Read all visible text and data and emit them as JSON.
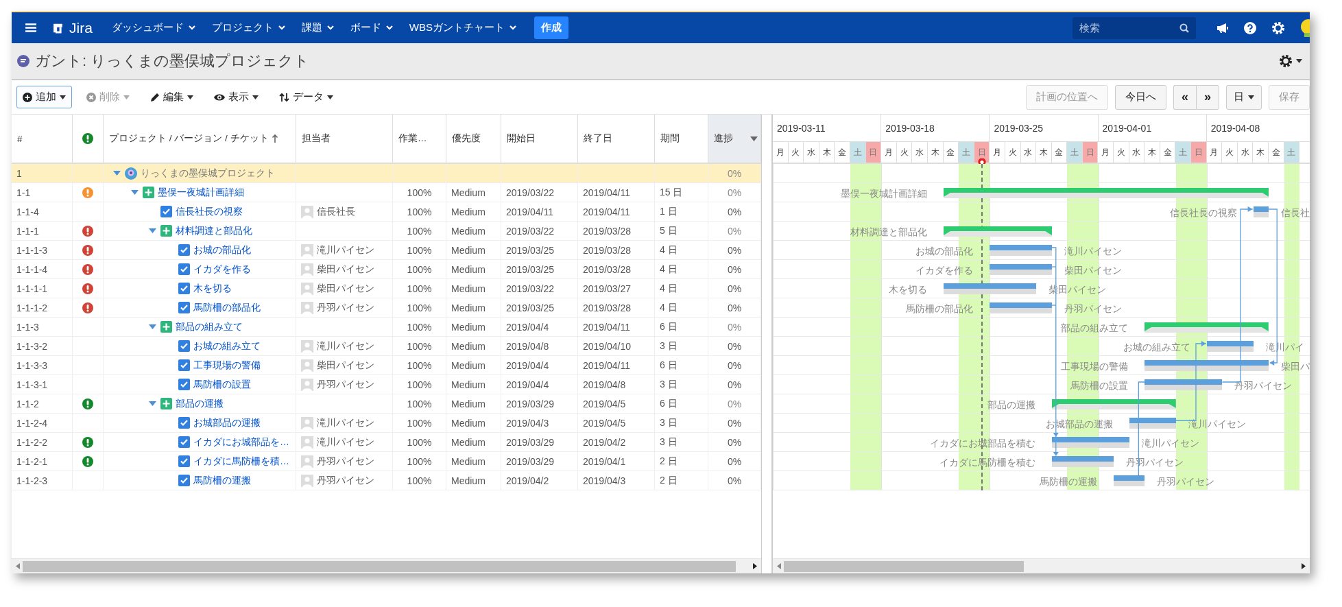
{
  "nav": {
    "logo": "Jira",
    "items": [
      {
        "label": "ダッシュボード"
      },
      {
        "label": "プロジェクト"
      },
      {
        "label": "課題"
      },
      {
        "label": "ボード"
      },
      {
        "label": "WBSガントチャート"
      }
    ],
    "create": "作成",
    "search": {
      "placeholder": "検索"
    }
  },
  "page": {
    "title": "ガント: りっくまの墨俣城プロジェクト"
  },
  "toolbar": {
    "left": [
      {
        "label": "追加",
        "kind": "plus",
        "disabled": false,
        "focused": true
      },
      {
        "label": "削除",
        "kind": "remove",
        "disabled": true,
        "focused": false
      },
      {
        "label": "編集",
        "kind": "pencil",
        "disabled": false,
        "focused": false
      },
      {
        "label": "表示",
        "kind": "eye",
        "disabled": false,
        "focused": false
      },
      {
        "label": "データ",
        "kind": "sort",
        "disabled": false,
        "focused": false
      }
    ],
    "right": [
      {
        "kind": "button",
        "label": "計画の位置へ",
        "disabled": true
      },
      {
        "kind": "button",
        "label": "今日へ",
        "disabled": false
      },
      {
        "kind": "pager",
        "labels": [
          "«",
          "»"
        ]
      },
      {
        "kind": "dropdown",
        "label": "日"
      },
      {
        "kind": "button",
        "label": "保存",
        "disabled": true
      }
    ]
  },
  "table": {
    "columns": [
      {
        "label": "#"
      },
      {
        "color": "#14892c"
      },
      {
        "label": "プロジェクト / バージョン / チケット",
        "sorted": true
      },
      {
        "label": "担当者"
      },
      {
        "label": "作業…"
      },
      {
        "label": "優先度"
      },
      {
        "label": "開始日"
      },
      {
        "label": "終了日"
      },
      {
        "label": "期間"
      },
      {
        "label": "進捗",
        "menu": true
      }
    ],
    "rows": [
      {
        "id": "1",
        "kind": "project",
        "name": "りっくまの墨俣城プロジェクト",
        "expanded": true,
        "progress": "0%",
        "children": [
          {
            "id": "1-1",
            "kind": "epic",
            "color": "#f79232",
            "name": "墨俣一夜城計画詳細",
            "expanded": true,
            "work": "100%",
            "level_text": "Medium",
            "start": "2019/03/22",
            "end": "2019/04/11",
            "duration": "15 日",
            "progress": "0%",
            "bar": {
              "label": "墨俣一夜城計画詳細"
            },
            "children": [
              {
                "id": "1-1-4",
                "kind": "task",
                "name": "信長社長の視察",
                "assignee": "信長社長",
                "work": "100%",
                "level_text": "Medium",
                "start": "2019/04/11",
                "end": "2019/04/11",
                "duration": "1 日",
                "progress": "0%",
                "bar": {
                  "label": "信長社長の視察",
                  "assignee": "信長社"
                }
              },
              {
                "id": "1-1-1",
                "kind": "epic",
                "color": "#d04437",
                "name": "材料調達と部品化",
                "expanded": true,
                "work": "100%",
                "level_text": "Medium",
                "start": "2019/03/22",
                "end": "2019/03/28",
                "duration": "5 日",
                "progress": "0%",
                "bar": {
                  "label": "材料調達と部品化"
                },
                "children": [
                  {
                    "id": "1-1-1-3",
                    "kind": "task",
                    "color": "#d04437",
                    "name": "お城の部品化",
                    "assignee": "滝川パイセン",
                    "work": "100%",
                    "level_text": "Medium",
                    "start": "2019/03/25",
                    "end": "2019/03/28",
                    "duration": "4 日",
                    "progress": "0%",
                    "bar": {
                      "label": "お城の部品化",
                      "assignee": "滝川パイセン"
                    }
                  },
                  {
                    "id": "1-1-1-4",
                    "kind": "task",
                    "color": "#d04437",
                    "name": "イカダを作る",
                    "assignee": "柴田パイセン",
                    "work": "100%",
                    "level_text": "Medium",
                    "start": "2019/03/25",
                    "end": "2019/03/28",
                    "duration": "4 日",
                    "progress": "0%",
                    "bar": {
                      "label": "イカダを作る",
                      "assignee": "柴田パイセン"
                    }
                  },
                  {
                    "id": "1-1-1-1",
                    "kind": "task",
                    "color": "#d04437",
                    "name": "木を切る",
                    "assignee": "柴田パイセン",
                    "work": "100%",
                    "level_text": "Medium",
                    "start": "2019/03/22",
                    "end": "2019/03/27",
                    "duration": "4 日",
                    "progress": "0%",
                    "bar": {
                      "label": "木を切る",
                      "assignee": "柴田パイセン"
                    }
                  },
                  {
                    "id": "1-1-1-2",
                    "kind": "task",
                    "color": "#d04437",
                    "name": "馬防柵の部品化",
                    "assignee": "丹羽パイセン",
                    "work": "100%",
                    "level_text": "Medium",
                    "start": "2019/03/25",
                    "end": "2019/03/28",
                    "duration": "4 日",
                    "progress": "0%",
                    "bar": {
                      "label": "馬防柵の部品化",
                      "assignee": "丹羽パイセン"
                    }
                  }
                ]
              },
              {
                "id": "1-1-3",
                "kind": "epic",
                "name": "部品の組み立て",
                "expanded": true,
                "work": "100%",
                "level_text": "Medium",
                "start": "2019/04/4",
                "end": "2019/04/11",
                "duration": "6 日",
                "progress": "0%",
                "bar": {
                  "label": "部品の組み立て"
                },
                "children": [
                  {
                    "id": "1-1-3-2",
                    "kind": "task",
                    "name": "お城の組み立て",
                    "assignee": "滝川パイセン",
                    "work": "100%",
                    "level_text": "Medium",
                    "start": "2019/04/8",
                    "end": "2019/04/10",
                    "duration": "3 日",
                    "progress": "0%",
                    "bar": {
                      "label": "お城の組み立て",
                      "assignee": "滝川パイ"
                    }
                  },
                  {
                    "id": "1-1-3-3",
                    "kind": "task",
                    "name": "工事現場の警備",
                    "assignee": "柴田パイセン",
                    "work": "100%",
                    "level_text": "Medium",
                    "start": "2019/04/4",
                    "end": "2019/04/11",
                    "duration": "6 日",
                    "progress": "0%",
                    "bar": {
                      "label": "工事現場の警備",
                      "assignee": "柴田パ"
                    }
                  },
                  {
                    "id": "1-1-3-1",
                    "kind": "task",
                    "name": "馬防柵の設置",
                    "assignee": "丹羽パイセン",
                    "work": "100%",
                    "level_text": "Medium",
                    "start": "2019/04/4",
                    "end": "2019/04/8",
                    "duration": "3 日",
                    "progress": "0%",
                    "bar": {
                      "label": "馬防柵の設置",
                      "assignee": "丹羽パイセン"
                    }
                  }
                ]
              },
              {
                "id": "1-1-2",
                "kind": "epic",
                "color": "#14892c",
                "name": "部品の運搬",
                "expanded": true,
                "work": "100%",
                "level_text": "Medium",
                "start": "2019/03/29",
                "end": "2019/04/5",
                "duration": "6 日",
                "progress": "0%",
                "bar": {
                  "label": "部品の運搬"
                },
                "children": [
                  {
                    "id": "1-1-2-4",
                    "kind": "task",
                    "name": "お城部品の運搬",
                    "assignee": "滝川パイセン",
                    "work": "100%",
                    "level_text": "Medium",
                    "start": "2019/04/3",
                    "end": "2019/04/5",
                    "duration": "3 日",
                    "progress": "0%",
                    "bar": {
                      "label": "お城部品の運搬",
                      "assignee": "滝川パイセン"
                    }
                  },
                  {
                    "id": "1-1-2-2",
                    "kind": "task",
                    "color": "#14892c",
                    "name": "イカダにお城部品を…",
                    "assignee": "滝川パイセン",
                    "work": "100%",
                    "level_text": "Medium",
                    "start": "2019/03/29",
                    "end": "2019/04/2",
                    "duration": "3 日",
                    "progress": "0%",
                    "bar": {
                      "label": "イカダにお城部品を積む",
                      "assignee": "滝川パイセン"
                    }
                  },
                  {
                    "id": "1-1-2-1",
                    "kind": "task",
                    "color": "#14892c",
                    "name": "イカダに馬防柵を積…",
                    "assignee": "丹羽パイセン",
                    "work": "100%",
                    "level_text": "Medium",
                    "start": "2019/03/29",
                    "end": "2019/04/1",
                    "duration": "2 日",
                    "progress": "0%",
                    "bar": {
                      "label": "イカダに馬防柵を積む",
                      "assignee": "丹羽パイセン"
                    }
                  },
                  {
                    "id": "1-1-2-3",
                    "kind": "task",
                    "name": "馬防柵の運搬",
                    "assignee": "丹羽パイセン",
                    "work": "100%",
                    "level_text": "Medium",
                    "start": "2019/04/2",
                    "end": "2019/04/3",
                    "duration": "2 日",
                    "progress": "0%",
                    "bar": {
                      "label": "馬防柵の運搬",
                      "assignee": "丹羽パイセン"
                    }
                  }
                ]
              }
            ]
          }
        ]
      }
    ]
  },
  "gantt": {
    "weeks": [
      "2019-03-11",
      "2019-03-18",
      "2019-03-25",
      "2019-04-01",
      "2019-04-08"
    ],
    "days": [
      {
        "label": "月",
        "kind": "weekday",
        "today": false
      },
      {
        "label": "火",
        "kind": "weekday",
        "today": false
      },
      {
        "label": "水",
        "kind": "weekday",
        "today": false
      },
      {
        "label": "木",
        "kind": "weekday",
        "today": false
      },
      {
        "label": "金",
        "kind": "weekday",
        "today": false
      },
      {
        "label": "土",
        "kind": "sat",
        "today": false
      },
      {
        "label": "日",
        "kind": "sun",
        "today": false
      },
      {
        "label": "月",
        "kind": "weekday",
        "today": false
      },
      {
        "label": "火",
        "kind": "weekday",
        "today": false
      },
      {
        "label": "水",
        "kind": "weekday",
        "today": false
      },
      {
        "label": "木",
        "kind": "weekday",
        "today": false
      },
      {
        "label": "金",
        "kind": "weekday",
        "today": false
      },
      {
        "label": "土",
        "kind": "sat",
        "today": false
      },
      {
        "label": "日",
        "kind": "sun",
        "today": true
      },
      {
        "label": "月",
        "kind": "weekday",
        "today": false
      },
      {
        "label": "火",
        "kind": "weekday",
        "today": false
      },
      {
        "label": "水",
        "kind": "weekday",
        "today": false
      },
      {
        "label": "木",
        "kind": "weekday",
        "today": false
      },
      {
        "label": "金",
        "kind": "weekday",
        "today": false
      },
      {
        "label": "土",
        "kind": "sat",
        "today": false
      },
      {
        "label": "日",
        "kind": "sun",
        "today": false
      },
      {
        "label": "月",
        "kind": "weekday",
        "today": false
      },
      {
        "label": "火",
        "kind": "weekday",
        "today": false
      },
      {
        "label": "水",
        "kind": "weekday",
        "today": false
      },
      {
        "label": "木",
        "kind": "weekday",
        "today": false
      },
      {
        "label": "金",
        "kind": "weekday",
        "today": false
      },
      {
        "label": "土",
        "kind": "sat",
        "today": false
      },
      {
        "label": "日",
        "kind": "sun",
        "today": false
      },
      {
        "label": "月",
        "kind": "weekday",
        "today": false
      },
      {
        "label": "火",
        "kind": "weekday",
        "today": false
      },
      {
        "label": "水",
        "kind": "weekday",
        "today": false
      },
      {
        "label": "木",
        "kind": "weekday",
        "today": false
      },
      {
        "label": "金",
        "kind": "weekday",
        "today": false
      },
      {
        "label": "土",
        "kind": "sat",
        "today": false
      }
    ]
  }
}
